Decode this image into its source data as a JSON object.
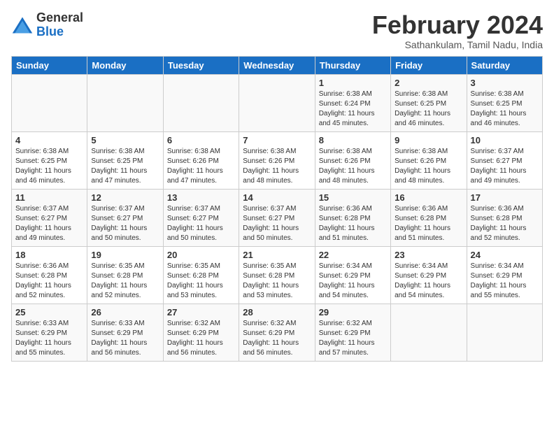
{
  "header": {
    "logo_general": "General",
    "logo_blue": "Blue",
    "month_title": "February 2024",
    "subtitle": "Sathankulam, Tamil Nadu, India"
  },
  "days_of_week": [
    "Sunday",
    "Monday",
    "Tuesday",
    "Wednesday",
    "Thursday",
    "Friday",
    "Saturday"
  ],
  "weeks": [
    [
      {
        "day": "",
        "content": ""
      },
      {
        "day": "",
        "content": ""
      },
      {
        "day": "",
        "content": ""
      },
      {
        "day": "",
        "content": ""
      },
      {
        "day": "1",
        "content": "Sunrise: 6:38 AM\nSunset: 6:24 PM\nDaylight: 11 hours\nand 45 minutes."
      },
      {
        "day": "2",
        "content": "Sunrise: 6:38 AM\nSunset: 6:25 PM\nDaylight: 11 hours\nand 46 minutes."
      },
      {
        "day": "3",
        "content": "Sunrise: 6:38 AM\nSunset: 6:25 PM\nDaylight: 11 hours\nand 46 minutes."
      }
    ],
    [
      {
        "day": "4",
        "content": "Sunrise: 6:38 AM\nSunset: 6:25 PM\nDaylight: 11 hours\nand 46 minutes."
      },
      {
        "day": "5",
        "content": "Sunrise: 6:38 AM\nSunset: 6:25 PM\nDaylight: 11 hours\nand 47 minutes."
      },
      {
        "day": "6",
        "content": "Sunrise: 6:38 AM\nSunset: 6:26 PM\nDaylight: 11 hours\nand 47 minutes."
      },
      {
        "day": "7",
        "content": "Sunrise: 6:38 AM\nSunset: 6:26 PM\nDaylight: 11 hours\nand 48 minutes."
      },
      {
        "day": "8",
        "content": "Sunrise: 6:38 AM\nSunset: 6:26 PM\nDaylight: 11 hours\nand 48 minutes."
      },
      {
        "day": "9",
        "content": "Sunrise: 6:38 AM\nSunset: 6:26 PM\nDaylight: 11 hours\nand 48 minutes."
      },
      {
        "day": "10",
        "content": "Sunrise: 6:37 AM\nSunset: 6:27 PM\nDaylight: 11 hours\nand 49 minutes."
      }
    ],
    [
      {
        "day": "11",
        "content": "Sunrise: 6:37 AM\nSunset: 6:27 PM\nDaylight: 11 hours\nand 49 minutes."
      },
      {
        "day": "12",
        "content": "Sunrise: 6:37 AM\nSunset: 6:27 PM\nDaylight: 11 hours\nand 50 minutes."
      },
      {
        "day": "13",
        "content": "Sunrise: 6:37 AM\nSunset: 6:27 PM\nDaylight: 11 hours\nand 50 minutes."
      },
      {
        "day": "14",
        "content": "Sunrise: 6:37 AM\nSunset: 6:27 PM\nDaylight: 11 hours\nand 50 minutes."
      },
      {
        "day": "15",
        "content": "Sunrise: 6:36 AM\nSunset: 6:28 PM\nDaylight: 11 hours\nand 51 minutes."
      },
      {
        "day": "16",
        "content": "Sunrise: 6:36 AM\nSunset: 6:28 PM\nDaylight: 11 hours\nand 51 minutes."
      },
      {
        "day": "17",
        "content": "Sunrise: 6:36 AM\nSunset: 6:28 PM\nDaylight: 11 hours\nand 52 minutes."
      }
    ],
    [
      {
        "day": "18",
        "content": "Sunrise: 6:36 AM\nSunset: 6:28 PM\nDaylight: 11 hours\nand 52 minutes."
      },
      {
        "day": "19",
        "content": "Sunrise: 6:35 AM\nSunset: 6:28 PM\nDaylight: 11 hours\nand 52 minutes."
      },
      {
        "day": "20",
        "content": "Sunrise: 6:35 AM\nSunset: 6:28 PM\nDaylight: 11 hours\nand 53 minutes."
      },
      {
        "day": "21",
        "content": "Sunrise: 6:35 AM\nSunset: 6:28 PM\nDaylight: 11 hours\nand 53 minutes."
      },
      {
        "day": "22",
        "content": "Sunrise: 6:34 AM\nSunset: 6:29 PM\nDaylight: 11 hours\nand 54 minutes."
      },
      {
        "day": "23",
        "content": "Sunrise: 6:34 AM\nSunset: 6:29 PM\nDaylight: 11 hours\nand 54 minutes."
      },
      {
        "day": "24",
        "content": "Sunrise: 6:34 AM\nSunset: 6:29 PM\nDaylight: 11 hours\nand 55 minutes."
      }
    ],
    [
      {
        "day": "25",
        "content": "Sunrise: 6:33 AM\nSunset: 6:29 PM\nDaylight: 11 hours\nand 55 minutes."
      },
      {
        "day": "26",
        "content": "Sunrise: 6:33 AM\nSunset: 6:29 PM\nDaylight: 11 hours\nand 56 minutes."
      },
      {
        "day": "27",
        "content": "Sunrise: 6:32 AM\nSunset: 6:29 PM\nDaylight: 11 hours\nand 56 minutes."
      },
      {
        "day": "28",
        "content": "Sunrise: 6:32 AM\nSunset: 6:29 PM\nDaylight: 11 hours\nand 56 minutes."
      },
      {
        "day": "29",
        "content": "Sunrise: 6:32 AM\nSunset: 6:29 PM\nDaylight: 11 hours\nand 57 minutes."
      },
      {
        "day": "",
        "content": ""
      },
      {
        "day": "",
        "content": ""
      }
    ]
  ]
}
